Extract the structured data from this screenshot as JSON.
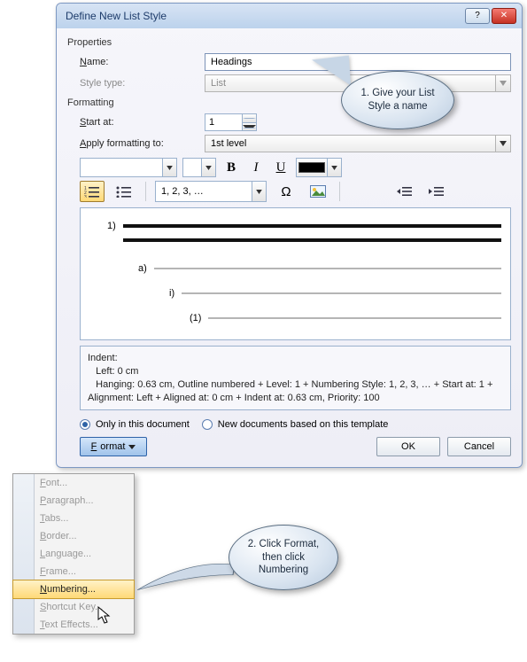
{
  "dialog": {
    "title": "Define New List Style",
    "sections": {
      "properties": "Properties",
      "formatting": "Formatting"
    },
    "fields": {
      "name_label": "Name:",
      "name_value": "Headings",
      "style_type_label": "Style type:",
      "style_type_value": "List",
      "start_at_label": "Start at:",
      "start_at_value": "1",
      "apply_to_label": "Apply formatting to:",
      "apply_to_value": "1st level"
    },
    "toolbar": {
      "bold": "B",
      "italic": "I",
      "underline": "U"
    },
    "numbering_combo": "1, 2, 3, …",
    "omega": "Ω",
    "preview": {
      "l1": "1)",
      "l2": "a)",
      "l3": "i)",
      "l4": "(1)"
    },
    "description": {
      "line1": "Indent:",
      "line2": "Left:  0 cm",
      "line3": "Hanging:  0.63 cm, Outline numbered + Level: 1 + Numbering Style: 1, 2, 3, … + Start at: 1 + Alignment: Left + Aligned at:  0 cm + Indent at:  0.63 cm, Priority: 100"
    },
    "radio": {
      "only_doc": "Only in this document",
      "new_docs": "New documents based on this template"
    },
    "buttons": {
      "format": "Format",
      "ok": "OK",
      "cancel": "Cancel"
    }
  },
  "menu": {
    "items": [
      "Font...",
      "Paragraph...",
      "Tabs...",
      "Border...",
      "Language...",
      "Frame...",
      "Numbering...",
      "Shortcut Key...",
      "Text Effects..."
    ],
    "active_index": 6
  },
  "callouts": {
    "c1": "1. Give your List Style a name",
    "c2": "2. Click Format, then click Numbering"
  }
}
